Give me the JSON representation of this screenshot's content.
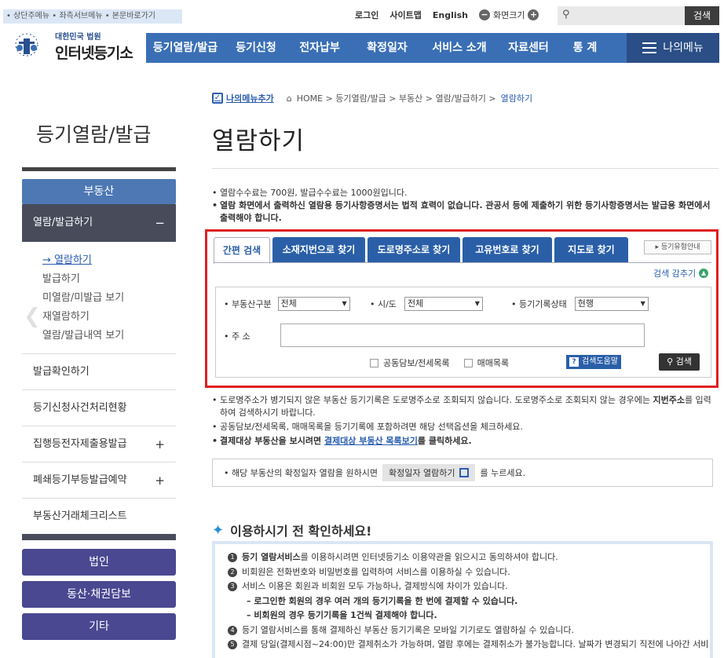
{
  "skip_links": "• 상단주메뉴 • 좌측서브메뉴 • 본문바로가기",
  "top_links": {
    "login": "로그인",
    "sitemap": "사이트맵",
    "english": "English",
    "zoom_label": "화면크기",
    "zoom_minus": "−",
    "zoom_plus": "+"
  },
  "search": {
    "button": "검색",
    "placeholder": ""
  },
  "logo": {
    "small": "대한민국 법원",
    "large": "인터넷등기소"
  },
  "gnb": [
    "등기열람/발급",
    "등기신청",
    "전자납부",
    "확정일자",
    "서비스 소개",
    "자료센터",
    "통 계"
  ],
  "my_menu": "나의메뉴",
  "sidebar": {
    "title": "등기열람/발급",
    "section": "부동산",
    "selected": "열람/발급하기",
    "selected_toggle": "−",
    "sub_items": [
      "→ 열람하기",
      "발급하기",
      "미열람/미발급 보기",
      "재열람하기",
      "열람/발급내역 보기"
    ],
    "items": [
      {
        "label": "발급확인하기",
        "toggle": ""
      },
      {
        "label": "등기신청사건처리현황",
        "toggle": ""
      },
      {
        "label": "집행등전자제출용발급",
        "toggle": "+"
      },
      {
        "label": "폐쇄등기부등발급예약",
        "toggle": "+"
      },
      {
        "label": "부동산거래체크리스트",
        "toggle": ""
      }
    ],
    "buttons": [
      "법인",
      "동산·채권담보",
      "기타"
    ]
  },
  "breadcrumb": {
    "add_menu": "나의메뉴추가",
    "path": "HOME > 등기열람/발급 > 부동산 > 열람/발급하기 >",
    "current": "열람하기"
  },
  "page_title": "열람하기",
  "notice": [
    "열람수수료는 700원, 발급수수료는 1000원입니다.",
    "열람 화면에서 출력하신 열람용 등기사항증명서는 법적 효력이 없습니다. 관공서 등에 제출하기 위한 등기사항증명서는 발급용 화면에서 출력해야 합니다."
  ],
  "tabs": [
    "간편 검색",
    "소재지번으로 찾기",
    "도로명주소로 찾기",
    "고유번호로 찾기",
    "지도로 찾기"
  ],
  "guide_button": "▸ 등기유형안내",
  "fold": "검색 감추기",
  "form": {
    "type_label": "• 부동산구분",
    "type_value": "전체",
    "city_label": "• 시/도",
    "city_value": "전체",
    "status_label": "• 등기기록상태",
    "status_value": "현행",
    "address_label": "• 주 소",
    "address_value": "",
    "check1": "공동담보/전세목록",
    "check2": "매매목록",
    "help": "검색도움말",
    "help_q": "?",
    "search_btn": "검색"
  },
  "notes": {
    "n1_a": "도로명주소가 병기되지 않은 부동산 등기기록은 도로명주소로 조회되지 않습니다. 도로명주소로 조회되지 않는 경우에는 ",
    "n1_b": "지번주소",
    "n1_c": "를 입력하여 검색하시기 바랍니다.",
    "n2": "공동담보/전세목록, 매매목록을 등기기록에 포함하려면 해당 선택옵션을 체크하세요.",
    "n3_a": "결제대상 부동산을 보시려면 ",
    "n3_b": "결제대상 부동산 목록보기",
    "n3_c": "를 클릭하세요."
  },
  "infobox": {
    "pre": "• 해당 부동산의 확정일자 열람을 원하시면",
    "button": "확정일자 열람하기",
    "post": "를 누르세요."
  },
  "check_title": "이용하시기 전 확인하세요!",
  "check_items": [
    {
      "num": "1",
      "bold": "등기 열람서비스",
      "text": "를 이용하시려면 인터넷등기소 이용약관을 읽으시고 동의하셔야 합니다."
    },
    {
      "num": "2",
      "bold": "",
      "text": "비회원은 전화번호와 비밀번호를 입력하여 서비스를 이용하실 수 있습니다."
    },
    {
      "num": "3",
      "bold": "",
      "text": "서비스 이용은 회원과 비회원 모두 가능하나, 결제방식에 차이가 있습니다."
    },
    {
      "num": "4",
      "bold": "",
      "text": "등기 열람서비스를 통해 결제하신 부동산 등기기록은 모바일 기기로도 열람하실 수 있습니다."
    },
    {
      "num": "5",
      "bold": "",
      "text": "결제 당일(결제시점~24:00)만 결제취소가 가능하며, 열람 후에는 결제취소가 불가능합니다. 날짜가 변경되기 직전에 나아간 서비"
    }
  ],
  "check_subs": [
    "– 로그인한 회원의 경우 여러 개의 등기기록을 한 번에 결제할 수 있습니다.",
    "– 비회원의 경우 등기기록을 1건씩 결제해야 합니다."
  ]
}
